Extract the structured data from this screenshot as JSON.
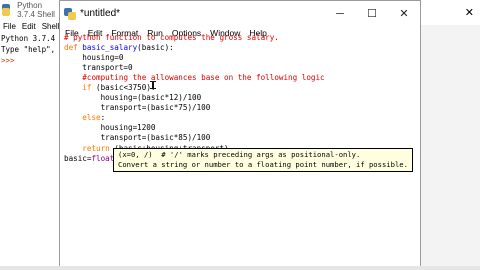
{
  "shell": {
    "title": "Python 3.7.4 Shell",
    "menu": [
      "File",
      "Edit",
      "Shell"
    ],
    "lines": [
      "Python 3.7.4",
      "Type \"help\", \"",
      ">>>"
    ]
  },
  "editor": {
    "title": "*untitled*",
    "menu": [
      "File",
      "Edit",
      "Format",
      "Run",
      "Options",
      "Window",
      "Help"
    ],
    "window_controls": {
      "minimize": "─",
      "maximize": "☐",
      "close": "✕"
    },
    "code": [
      "# python function to computes the gross salary.",
      "def basic_salary(basic):",
      "    housing=0",
      "    transport=0",
      "    #computing the allowances base on the following logic",
      "    if (basic<3750):",
      "        housing=(basic*12)/100",
      "        transport=(basic*75)/100",
      "    else:",
      "        housing=1200",
      "        transport=(basic*85)/100",
      "    return (basic+housing+transport)",
      "basic=float(input"
    ],
    "calltip": [
      "(x=0, /)  # '/' marks preceding args as positional-only.",
      "Convert a string or number to a floating point number, if possible."
    ]
  },
  "right_panel": {
    "close_icon": "✕"
  },
  "icons": {
    "python": "python-logo-icon"
  }
}
